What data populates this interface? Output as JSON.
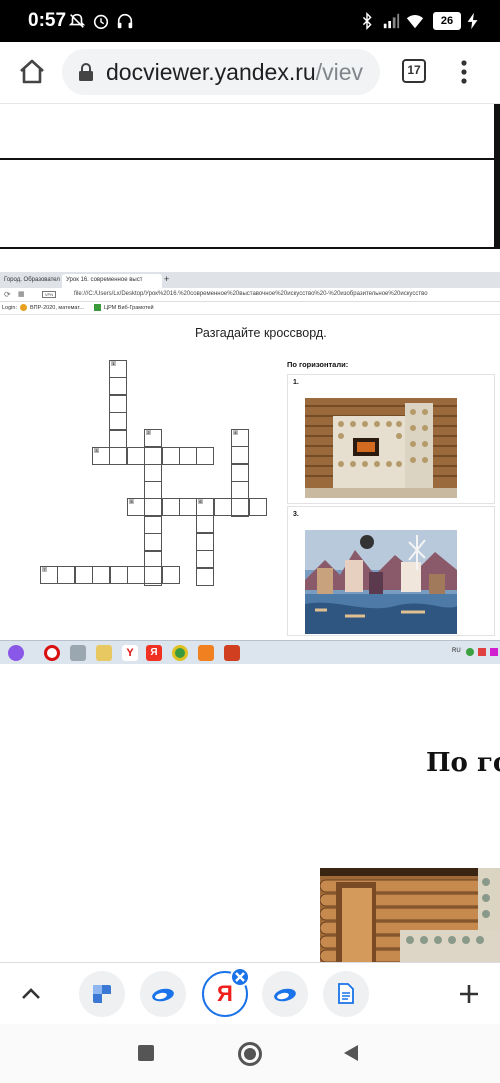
{
  "status_bar": {
    "time": "0:57",
    "battery": "26"
  },
  "browser": {
    "url_host": "docviewer.yandex.ru",
    "url_path": "/viev",
    "tab_count": "17"
  },
  "embedded": {
    "tabs": [
      "Город. Образовател",
      "Урок 16. современное выст",
      "+"
    ],
    "address": "file:///C:/Users/Lx/Desktop/Урок%2016.%20современное%20выставочное%20искусство%20-%20изобразительное%20искусство",
    "bookmarks": [
      "Login:",
      "ВПР-2020, математ...",
      "ЦРМ Виб-Грамотей"
    ],
    "crossword_title": "Разгадайте кроссворд.",
    "clues_heading": "По горизонтали:",
    "clue_numbers": [
      "1.",
      "3."
    ],
    "cell_numbers": [
      "1",
      "2",
      "3",
      "4",
      "5",
      "6",
      "7"
    ],
    "taskbar_lang": "RU"
  },
  "document": {
    "heading": "По го"
  },
  "colors": {
    "accent": "#1a73e8",
    "yandex_red": "#f0201c",
    "close_badge": "#1a73e8"
  },
  "icons": {
    "home": "home-icon",
    "lock": "lock-icon",
    "menu": "more-vert-icon",
    "up": "chevron-up-icon",
    "plus": "plus-icon"
  }
}
